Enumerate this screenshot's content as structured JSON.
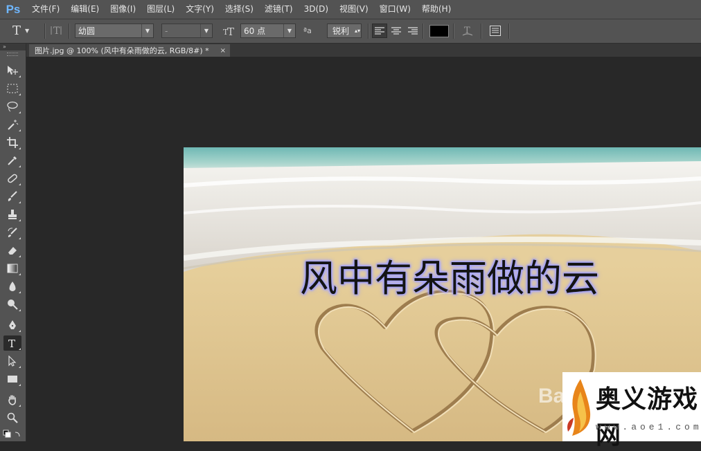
{
  "app": {
    "logo": "Ps"
  },
  "menu": [
    "文件(F)",
    "编辑(E)",
    "图像(I)",
    "图层(L)",
    "文字(Y)",
    "选择(S)",
    "滤镜(T)",
    "3D(D)",
    "视图(V)",
    "窗口(W)",
    "帮助(H)"
  ],
  "options": {
    "tool_glyph": "T",
    "font_family": "幼圆",
    "font_style": "-",
    "font_size": "60 点",
    "aa_label": "ªa",
    "antialias": "锐利",
    "text_color": "#000000",
    "align_options": [
      "left",
      "center",
      "right"
    ],
    "active_align": "left"
  },
  "document": {
    "tab_title": "图片.jpg @ 100% (风中有朵雨做的云, RGB/8#) *",
    "close_glyph": "×"
  },
  "canvas": {
    "overlay_text": "风中有朵雨做的云",
    "text_glow_color": "#a9a8ff"
  },
  "watermarks": {
    "baidu": "Ba",
    "site_title": "奥义游戏网",
    "site_url": "www.aoe1.com"
  },
  "tools": [
    "move",
    "marquee",
    "lasso",
    "magic-wand",
    "crop",
    "eyedropper",
    "healing-brush",
    "brush",
    "clone-stamp",
    "history-brush",
    "eraser",
    "gradient",
    "blur",
    "dodge",
    "pen",
    "type",
    "path-selection",
    "rectangle",
    "hand",
    "zoom"
  ],
  "active_tool": "type"
}
